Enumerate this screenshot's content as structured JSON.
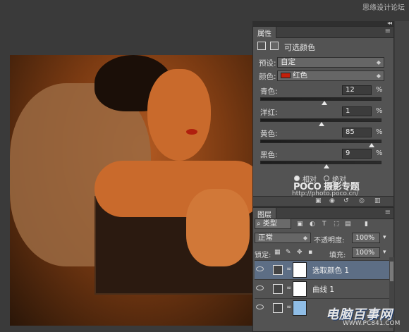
{
  "watermark_top": "思缘设计论坛",
  "properties": {
    "tab": "属性",
    "panel_menu": "≡",
    "collapse_arrows": "◂◂",
    "title": "可选颜色",
    "preset_label": "预设:",
    "preset_value": "自定",
    "colors_label": "颜色:",
    "colors_value": "红色",
    "colors_swatch": "#c3200a",
    "sliders": [
      {
        "label": "青色:",
        "value": "12",
        "unit": "%",
        "level": 0.53
      },
      {
        "label": "洋红:",
        "value": "1",
        "unit": "%",
        "level": 0.505
      },
      {
        "label": "黄色:",
        "value": "85",
        "unit": "%",
        "level": 0.925
      },
      {
        "label": "黑色:",
        "value": "9",
        "unit": "%",
        "level": 0.545
      }
    ],
    "radio_relative": "相对",
    "radio_absolute": "绝对",
    "mode_selected": "relative"
  },
  "watermark": {
    "poco": "POCO 摄影专题",
    "poco_url": "http://photo.poco.cn/",
    "brand": "电脑百事网",
    "brand_url": "WWW.PC841.COM"
  },
  "layers": {
    "tab": "图层",
    "panel_menu": "≡",
    "filter_label": "类型",
    "blend_mode": "正常",
    "opacity_label": "不透明度:",
    "opacity_value": "100%",
    "lock_label": "锁定:",
    "fill_label": "填充:",
    "fill_value": "100%",
    "rows": [
      {
        "name": "选取颜色 1",
        "selected": true
      },
      {
        "name": "曲线 1",
        "selected": false
      },
      {
        "name": "",
        "selected": false
      }
    ]
  }
}
